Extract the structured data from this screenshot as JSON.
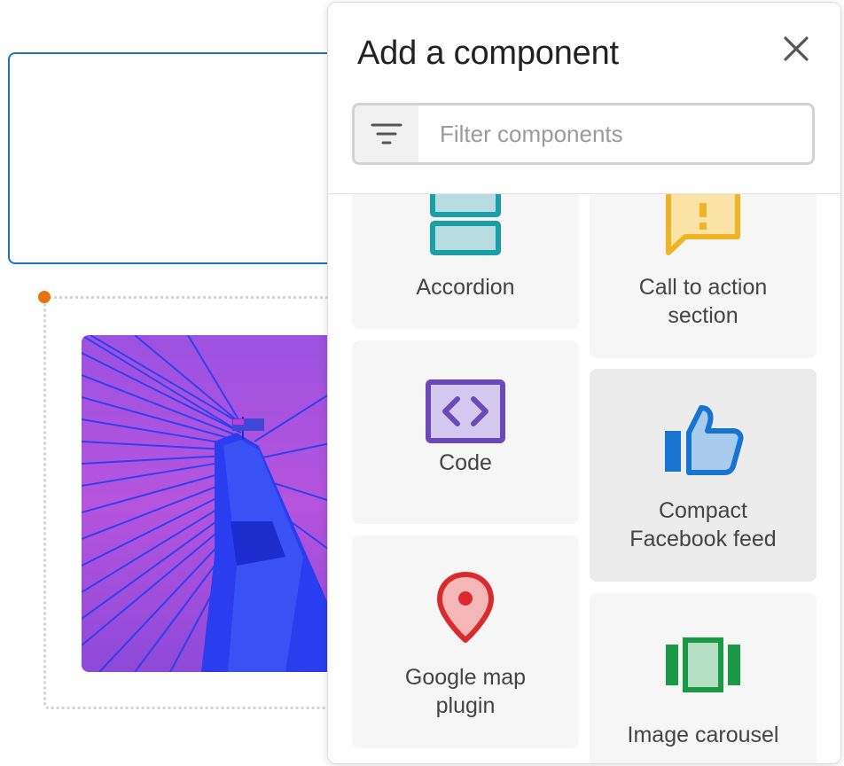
{
  "panel": {
    "title": "Add a component",
    "close_icon": "close-icon",
    "filter": {
      "icon": "filter-icon",
      "placeholder": "Filter components",
      "value": ""
    }
  },
  "components": [
    {
      "id": "accordion",
      "label": "Accordion",
      "icon": "accordion-icon",
      "color": "#1a9fa8"
    },
    {
      "id": "call-to-action",
      "label": "Call to action section",
      "icon": "call-to-action-icon",
      "color": "#f0b323"
    },
    {
      "id": "code",
      "label": "Code",
      "icon": "code-icon",
      "color": "#6c49b8"
    },
    {
      "id": "compact-facebook-feed",
      "label": "Compact Facebook feed",
      "icon": "thumbs-up-icon",
      "color": "#1775d1"
    },
    {
      "id": "google-map",
      "label": "Google map plugin",
      "icon": "map-pin-icon",
      "color": "#d92b2b"
    },
    {
      "id": "image-carousel",
      "label": "Image carousel",
      "icon": "carousel-icon",
      "color": "#1b9a46"
    }
  ],
  "canvas": {
    "selection_color": "#1a73c7",
    "handle_color": "#e8730c"
  }
}
